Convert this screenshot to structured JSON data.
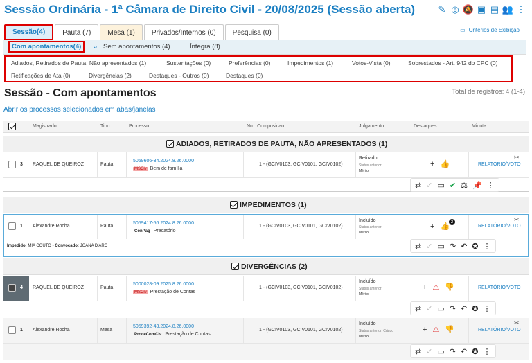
{
  "header": {
    "title": "Sessão Ordinária - 1ª Câmara de Direito Civil - 20/08/2025 (Sessão aberta)"
  },
  "tabs": [
    "Sessão(4)",
    "Pauta (7)",
    "Mesa (1)",
    "Privados/Internos (0)",
    "Pesquisa (0)"
  ],
  "criterios": "Critérios de Exibição",
  "subtabs": [
    "Com apontamentos(4)",
    "Sem apontamentos (4)",
    "Íntegra (8)"
  ],
  "filters": {
    "row1": [
      "Adiados, Retirados de Pauta, Não apresentados (1)",
      "Sustentações (0)",
      "Preferências (0)",
      "Impedimentos (1)",
      "Votos-Vista (0)",
      "Sobrestados - Art. 942 do CPC (0)"
    ],
    "row2": [
      "Retificações de Ata (0)",
      "Divergências (2)",
      "Destaques - Outros (0)",
      "Destaques (0)"
    ]
  },
  "page": {
    "title": "Sessão - Com apontamentos",
    "total": "Total de registros: 4 (1-4)",
    "open_link": "Abrir os processos selecionados em abas/janelas"
  },
  "columns": [
    "Magistrado",
    "Tipo",
    "Processo",
    "Nro. Composicao",
    "Julgamento",
    "Destaques",
    "Minuta"
  ],
  "groups": [
    {
      "title": "ADIADOS, RETIRADOS DE PAUTA, NÃO APRESENTADOS (1)"
    },
    {
      "title": "IMPEDIMENTOS (1)"
    },
    {
      "title": "DIVERGÊNCIAS (2)"
    }
  ],
  "rows": [
    {
      "num": "3",
      "magistrado": "RAQUEL DE QUEIROZ",
      "tipo": "Pauta",
      "processo": "5059606-34.2024.8.26.0000",
      "tag": "MSCiv",
      "assunto": "Bem de família",
      "composicao": "1 - (GCIV0103, GCIV0101, GCIV0102)",
      "julg": "Retirado",
      "status_label": "Status anterior:",
      "status_prev": "",
      "merito": "Mérito",
      "minuta": "RELATÓRIO/VOTO"
    },
    {
      "num": "1",
      "magistrado": "Alexandre Rocha",
      "tipo": "Pauta",
      "processo": "5059417-56.2024.8.26.0000",
      "tag": "ConPag",
      "assunto": "Precatório",
      "composicao": "1 - (GCIV0103, GCIV0101, GCIV0102)",
      "julg": "Incluído",
      "status_label": "Status anterior:",
      "status_prev": "",
      "merito": "Mérito",
      "minuta": "RELATÓRIO/VOTO",
      "badge": "2"
    },
    {
      "num": "4",
      "magistrado": "RAQUEL DE QUEIROZ",
      "tipo": "Pauta",
      "processo": "5000028-09.2025.8.26.0000",
      "tag": "MSCiv",
      "assunto": "Prestação de Contas",
      "composicao": "1 - (GCIV0103, GCIV0101, GCIV0102)",
      "julg": "Incluído",
      "status_label": "Status anterior:",
      "status_prev": "",
      "merito": "Mérito",
      "minuta": "RELATÓRIO/VOTO"
    },
    {
      "num": "1",
      "magistrado": "Alexandre Rocha",
      "tipo": "Mesa",
      "processo": "5059392-43.2024.8.26.0000",
      "tag": "ProceComCiv",
      "assunto": "Prestação de Contas",
      "composicao": "1 - (GCIV0103, GCIV0101, GCIV0102)",
      "julg": "Incluído",
      "status_label": "Status anterior:",
      "status_prev": "Criado",
      "merito": "Mérito",
      "minuta": "RELATÓRIO/VOTO"
    }
  ],
  "impedido": {
    "label1": "Impedido:",
    "value1": "MIA COUTO",
    "sep": " - ",
    "label2": "Convocado:",
    "value2": "JOANA D'ARC"
  },
  "icons": {
    "plus": "+",
    "thumb": "👍",
    "thumbdown": "👎",
    "warning": "⚠"
  },
  "colors": {
    "accent": "#1b7fc2",
    "highlight": "#dd0000"
  }
}
